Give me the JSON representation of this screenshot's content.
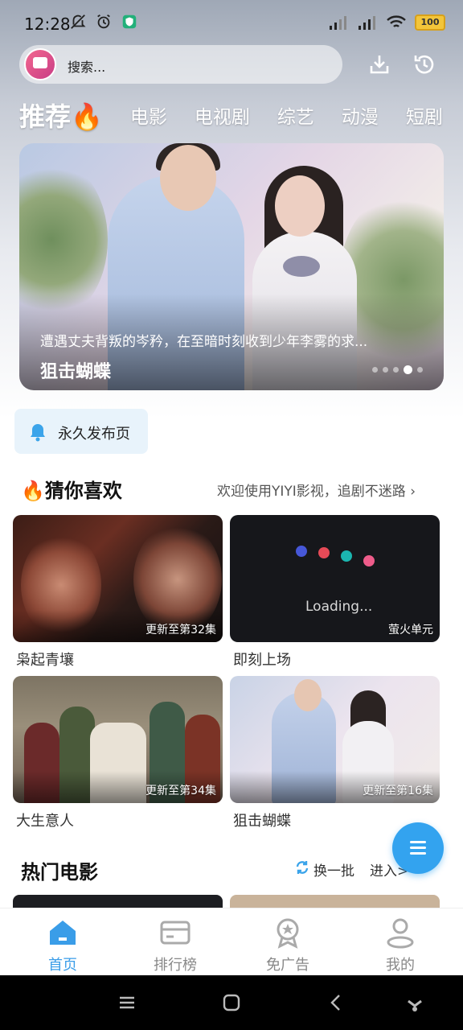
{
  "status_bar": {
    "time": "12:28",
    "battery": "100"
  },
  "search": {
    "placeholder": "搜索..."
  },
  "tabs": [
    {
      "label": "推荐🔥",
      "active": true
    },
    {
      "label": "电影"
    },
    {
      "label": "电视剧"
    },
    {
      "label": "综艺"
    },
    {
      "label": "动漫"
    },
    {
      "label": "短剧"
    }
  ],
  "banner": {
    "subtitle": "遭遇丈夫背叛的岑矜，在至暗时刻收到少年李雾的求...",
    "title": "狙击蝴蝶",
    "dot_count": 5,
    "active_dot": 4
  },
  "chip": {
    "label": "永久发布页"
  },
  "guess": {
    "title": "🔥猜你喜欢",
    "right_text": "欢迎使用YIYI影视，追剧不迷路 ›",
    "cards": [
      {
        "title": "枭起青壤",
        "badge": "更新至第32集"
      },
      {
        "title": "即刻上场",
        "badge": "萤火单元",
        "loading_text": "Loading..."
      },
      {
        "title": "大生意人",
        "badge": "更新至第34集"
      },
      {
        "title": "狙击蝴蝶",
        "badge": "更新至第16集"
      }
    ]
  },
  "hot": {
    "title": "热门电影",
    "refresh": "换一批",
    "enter": "进入>",
    "enter_partial": "进入分类 ›"
  },
  "bottom_nav": [
    {
      "label": "首页",
      "icon": "home-icon",
      "active": true
    },
    {
      "label": "排行榜",
      "icon": "ranking-icon"
    },
    {
      "label": "免广告",
      "icon": "ad-free-icon"
    },
    {
      "label": "我的",
      "icon": "profile-icon"
    }
  ],
  "colors": {
    "accent": "#3a9de8",
    "fab": "#33a3ef",
    "chip_bg": "#e8f3fb"
  }
}
